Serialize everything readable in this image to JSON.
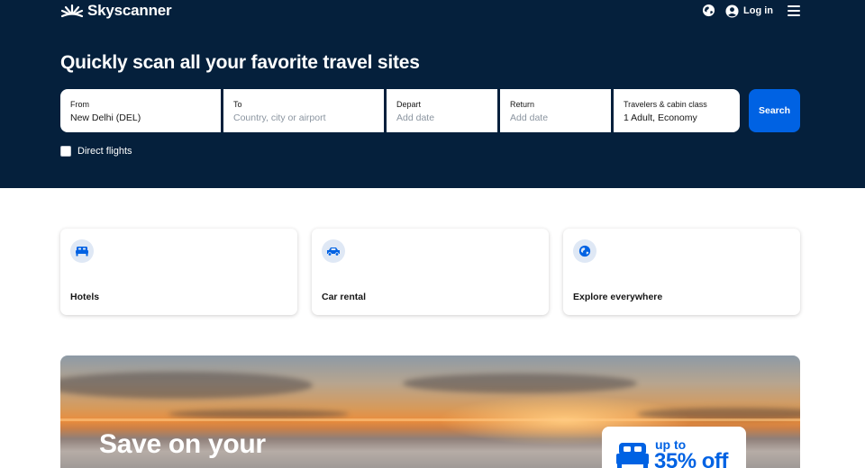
{
  "header": {
    "brand": "Skyscanner",
    "login_label": "Log in"
  },
  "hero": {
    "title": "Quickly scan all your favorite travel sites"
  },
  "search": {
    "from": {
      "label": "From",
      "value": "New Delhi (DEL)"
    },
    "to": {
      "label": "To",
      "placeholder": "Country, city or airport"
    },
    "depart": {
      "label": "Depart",
      "placeholder": "Add date"
    },
    "return": {
      "label": "Return",
      "placeholder": "Add date"
    },
    "travelers": {
      "label": "Travelers & cabin class",
      "value": "1 Adult, Economy"
    },
    "button_label": "Search",
    "direct_flights_label": "Direct flights",
    "direct_flights_checked": false
  },
  "quick_links": [
    {
      "label": "Hotels",
      "icon": "bed-icon"
    },
    {
      "label": "Car rental",
      "icon": "car-icon"
    },
    {
      "label": "Explore everywhere",
      "icon": "globe-icon"
    }
  ],
  "banner": {
    "title": "Save on your",
    "promo_line1": "up to",
    "promo_line2": "35% off"
  },
  "colors": {
    "navy": "#05203c",
    "primary_blue": "#0062e3",
    "icon_bg": "#dfe8f5"
  }
}
